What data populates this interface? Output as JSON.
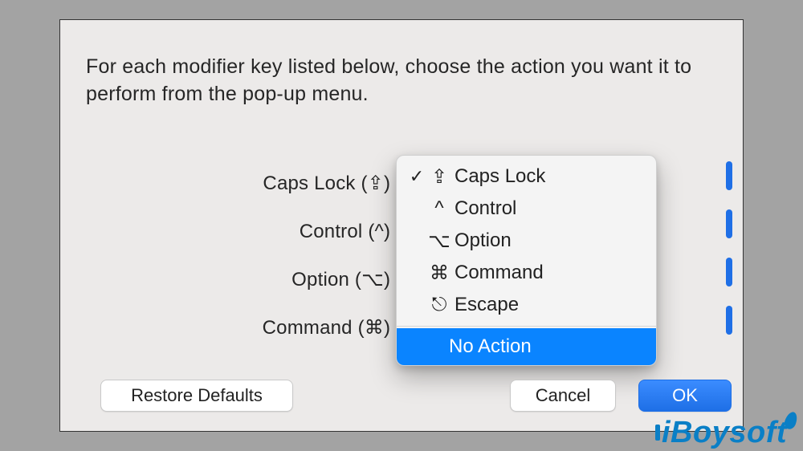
{
  "dialog": {
    "instruction": "For each modifier key listed below, choose the action you want it to perform from the pop-up menu.",
    "rows": {
      "capslock": {
        "label": "Caps Lock (⇪) Key"
      },
      "control": {
        "label": "Control (^) Key"
      },
      "option": {
        "label": "Option (⌥) Key"
      },
      "command": {
        "label": "Command (⌘) Key"
      }
    },
    "buttons": {
      "restore": "Restore Defaults",
      "cancel": "Cancel",
      "ok": "OK"
    }
  },
  "popup": {
    "items": [
      {
        "symbol": "⇪",
        "label": "Caps Lock",
        "checked": true
      },
      {
        "symbol": "^",
        "label": "Control",
        "checked": false
      },
      {
        "symbol": "⌥",
        "label": "Option",
        "checked": false
      },
      {
        "symbol": "⌘",
        "label": "Command",
        "checked": false
      },
      {
        "symbol": "⎋",
        "label": "Escape",
        "checked": false
      }
    ],
    "no_action_label": "No Action",
    "highlighted": "No Action"
  },
  "watermark": {
    "brand": "iBoysoft"
  },
  "colors": {
    "accent": "#0a84ff",
    "button_primary": "#1e6fe6",
    "panel_bg": "#eceae9",
    "page_bg": "#a3a3a3",
    "watermark": "#0a7fc6"
  }
}
